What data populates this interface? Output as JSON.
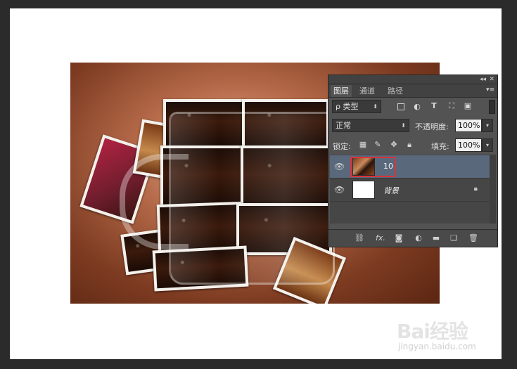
{
  "layers_panel": {
    "tabs": [
      {
        "label": "图层",
        "active": true
      },
      {
        "label": "通道",
        "active": false
      },
      {
        "label": "路径",
        "active": false
      }
    ],
    "filter": {
      "label": "ρ 类型"
    },
    "blend_mode": "正常",
    "opacity": {
      "label": "不透明度:",
      "value": "100%"
    },
    "lock": {
      "label": "锁定:"
    },
    "fill": {
      "label": "填充:",
      "value": "100%"
    },
    "layers": [
      {
        "name": "10",
        "selected": true,
        "visible": true
      },
      {
        "name": "背景",
        "selected": false,
        "visible": true,
        "locked": true
      }
    ],
    "filter_icons": [
      "pixel-icon",
      "adjustment-icon",
      "type-icon",
      "shape-icon",
      "smart-object-icon"
    ],
    "lock_icons": [
      "lock-transparent-icon",
      "lock-image-icon",
      "lock-position-icon",
      "lock-all-icon"
    ],
    "bottom_icons": [
      "link-icon",
      "fx-icon",
      "mask-icon",
      "adjustment-layer-icon",
      "group-folder-icon",
      "new-layer-icon",
      "trash-icon"
    ],
    "fx_label": "fx."
  },
  "watermark": {
    "brand": "Bai经验",
    "sub": "jingyan.baidu.com"
  },
  "colors": {
    "selection": "#5a687c",
    "highlight": "#d9333a",
    "panel": "#535353"
  }
}
